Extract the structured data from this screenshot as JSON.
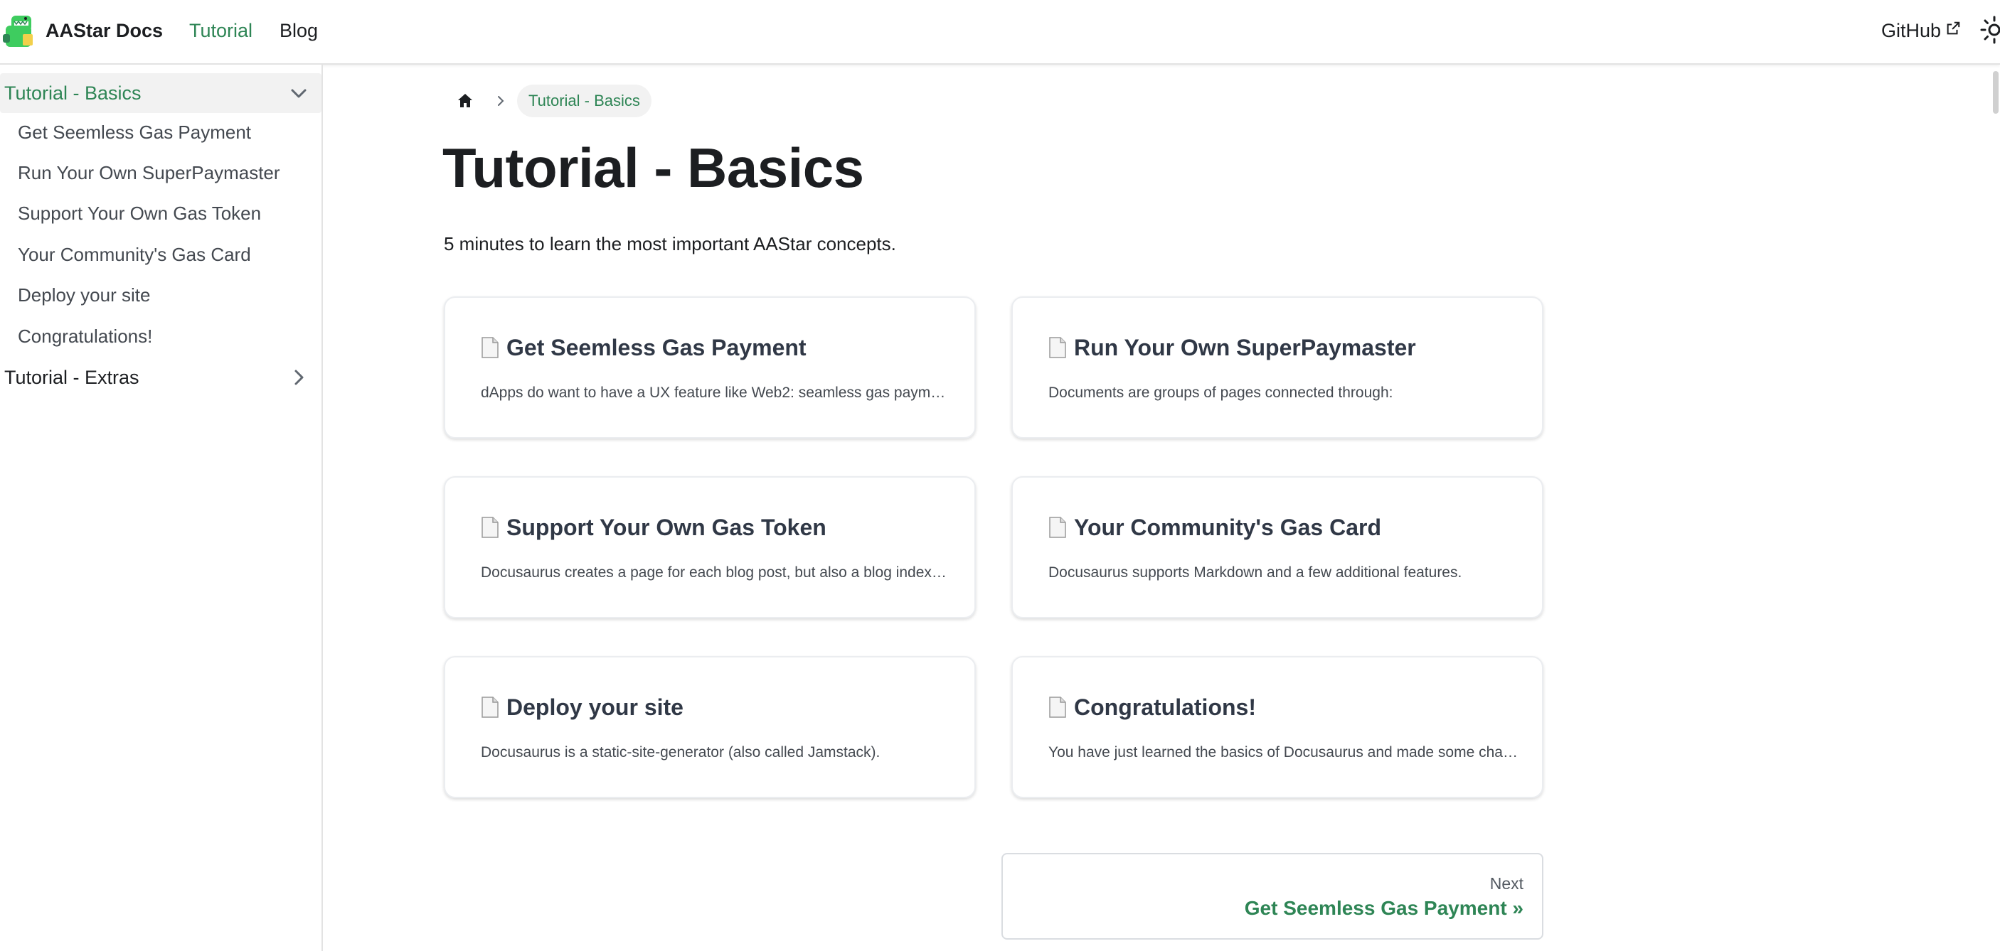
{
  "navbar": {
    "brand_title": "AAStar Docs",
    "links": {
      "tutorial": "Tutorial",
      "blog": "Blog",
      "github": "GitHub"
    },
    "active_link": "Tutorial"
  },
  "sidebar": {
    "categories": [
      {
        "label": "Tutorial - Basics",
        "expanded": true,
        "items": [
          "Get Seemless Gas Payment",
          "Run Your Own SuperPaymaster",
          "Support Your Own Gas Token",
          "Your Community's Gas Card",
          "Deploy your site",
          "Congratulations!"
        ]
      },
      {
        "label": "Tutorial - Extras",
        "expanded": false
      }
    ]
  },
  "breadcrumb": {
    "current": "Tutorial - Basics"
  },
  "main": {
    "title": "Tutorial - Basics",
    "description": "5 minutes to learn the most important AAStar concepts.",
    "cards": [
      {
        "title": "Get Seemless Gas Payment",
        "description": "dApps do want to have a UX feature like Web2: seamless gas payment..."
      },
      {
        "title": "Run Your Own SuperPaymaster",
        "description": "Documents are groups of pages connected through:"
      },
      {
        "title": "Support Your Own Gas Token",
        "description": "Docusaurus creates a page for each blog post, but also a blog index page..."
      },
      {
        "title": "Your Community's Gas Card",
        "description": "Docusaurus supports Markdown and a few additional features."
      },
      {
        "title": "Deploy your site",
        "description": "Docusaurus is a static-site-generator (also called Jamstack)."
      },
      {
        "title": "Congratulations!",
        "description": "You have just learned the basics of Docusaurus and made some changes..."
      }
    ]
  },
  "pagination": {
    "sublabel": "Next",
    "label": "Get Seemless Gas Payment »"
  },
  "colors": {
    "accent": "#2e8555",
    "text": "#1c1e21",
    "muted": "#444950",
    "border": "#e3e3e3"
  },
  "icons": {
    "logo": "dinosaur-logo-icon",
    "external": "external-link-icon",
    "theme": "sun-icon",
    "home": "home-icon",
    "breadcrumb_sep": "chevron-right-icon",
    "card": "document-icon",
    "expand": "chevron-down-icon",
    "collapse": "chevron-right-icon"
  }
}
